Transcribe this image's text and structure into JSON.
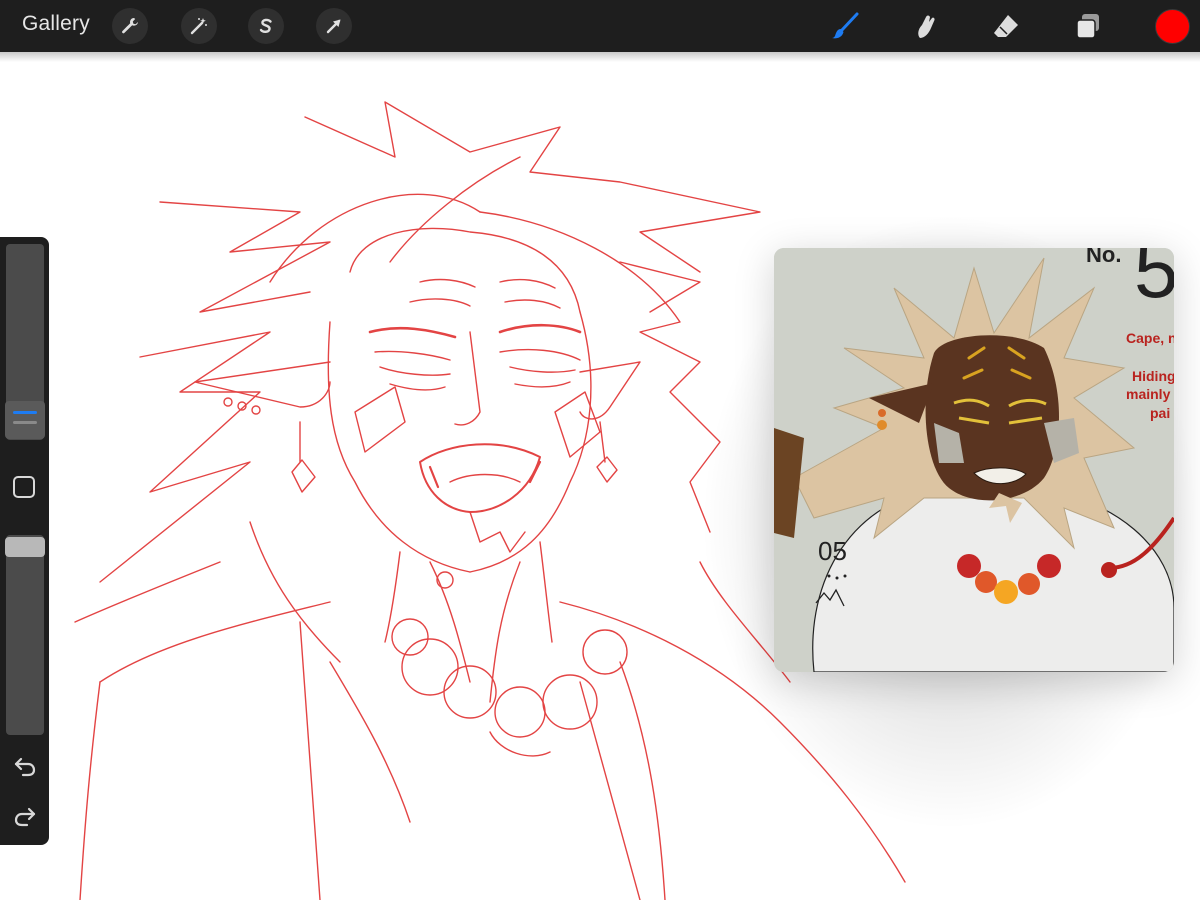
{
  "toolbar": {
    "gallery_label": "Gallery",
    "left_tools": [
      "wrench-icon",
      "magic-wand-icon",
      "selection-s-icon",
      "transform-arrow-icon"
    ],
    "right_tools": [
      "brush-icon",
      "smudge-icon",
      "eraser-icon",
      "layers-icon"
    ],
    "active_tool": "brush-icon",
    "accent_color": "#1e7cf2",
    "current_color": "#ff0000"
  },
  "sidebar": {
    "controls": [
      "brush-size-slider",
      "modify-button",
      "opacity-slider",
      "undo-icon",
      "redo-icon"
    ]
  },
  "canvas": {
    "sketch_stroke_color": "#e03030",
    "background": "#ffffff"
  },
  "reference": {
    "label_no": "No.",
    "label_number": "5",
    "note_line1": "Cape, n",
    "note_line2": "Hiding",
    "note_line3": "mainly",
    "note_line4": "pai",
    "mark_text": "05"
  }
}
